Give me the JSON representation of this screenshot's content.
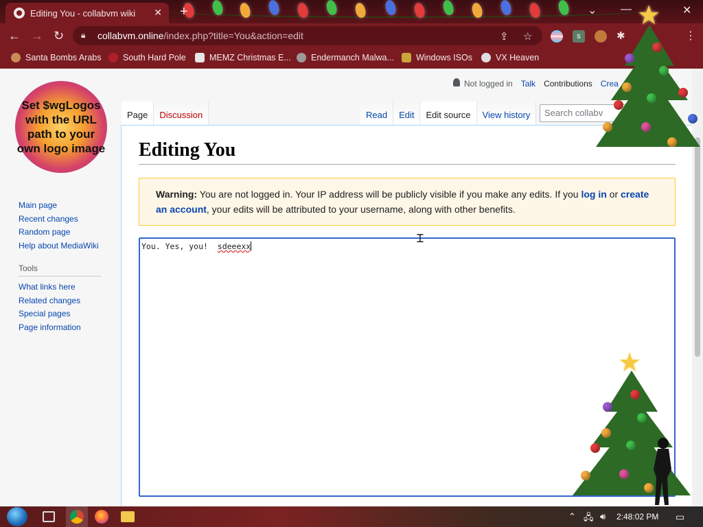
{
  "browser": {
    "tab_title": "Editing You - collabvm wiki",
    "url_host": "collabvm.online",
    "url_path": "/index.php?title=You&action=edit",
    "bookmarks": [
      "Santa Bombs Arabs",
      "South Hard Pole",
      "MEMZ Christmas E...",
      "Endermanch Malwa...",
      "Windows ISOs",
      "VX Heaven"
    ],
    "extension_letter": "s",
    "theme_colors": {
      "frame": "#5a1318",
      "toolbar": "#7a1b22",
      "omnibox": "#5a1218"
    }
  },
  "wiki": {
    "logo_text": "Set $wgLogos with the URL path to your own logo image",
    "personal": {
      "not_logged_in": "Not logged in",
      "talk": "Talk",
      "contributions": "Contributions",
      "create_account": "Crea"
    },
    "namespace_tabs": {
      "page": "Page",
      "discussion": "Discussion"
    },
    "view_tabs": {
      "read": "Read",
      "edit": "Edit",
      "edit_source": "Edit source",
      "view_history": "View history"
    },
    "search_placeholder": "Search collabv",
    "sidebar": {
      "navigation": [
        "Main page",
        "Recent changes",
        "Random page",
        "Help about MediaWiki"
      ],
      "tools_heading": "Tools",
      "tools": [
        "What links here",
        "Related changes",
        "Special pages",
        "Page information"
      ]
    },
    "heading": "Editing You",
    "warning": {
      "label": "Warning:",
      "text_before_login": " You are not logged in. Your IP address will be publicly visible if you make any edits. If you ",
      "login_link": "log in",
      "text_or": " or ",
      "create_link": "create an account",
      "text_after": ", your edits will be attributed to your username, along with other benefits."
    },
    "editor": {
      "text_plain": "You. Yes, you!  ",
      "text_misspelled": "sdeeexx"
    }
  },
  "taskbar": {
    "clock": "2:48:02 PM"
  }
}
